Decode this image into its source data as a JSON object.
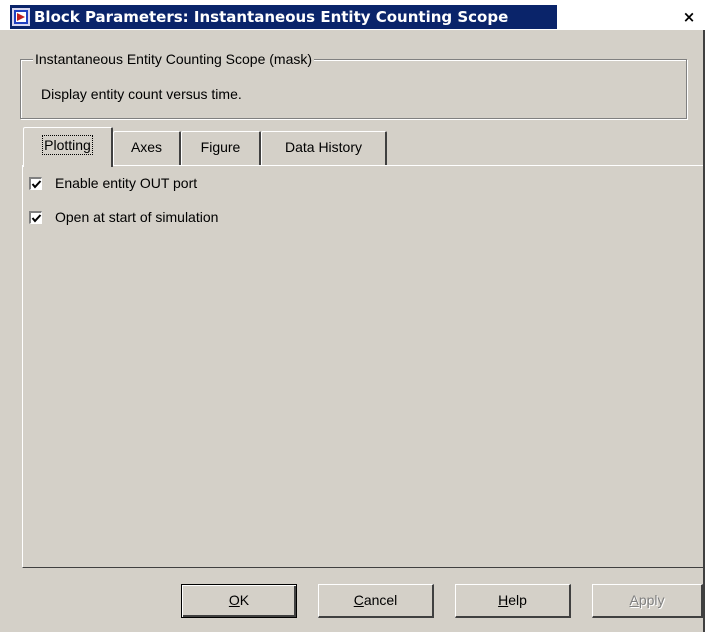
{
  "window": {
    "title": "Block Parameters: Instantaneous Entity Counting Scope",
    "close_label": "×"
  },
  "group": {
    "legend": "Instantaneous Entity Counting Scope (mask)",
    "description": "Display entity count versus time."
  },
  "tabs": [
    {
      "label": "Plotting",
      "active": true
    },
    {
      "label": "Axes",
      "active": false
    },
    {
      "label": "Figure",
      "active": false
    },
    {
      "label": "Data History",
      "active": false
    }
  ],
  "options": [
    {
      "label": "Enable entity OUT port",
      "checked": true
    },
    {
      "label": "Open at start of simulation",
      "checked": true
    }
  ],
  "buttons": {
    "ok": {
      "mnemonic": "O",
      "rest": "K"
    },
    "cancel": {
      "mnemonic": "C",
      "rest": "ancel"
    },
    "help": {
      "mnemonic": "H",
      "rest": "elp"
    },
    "apply": {
      "mnemonic": "A",
      "rest": "pply",
      "disabled": true
    }
  },
  "colors": {
    "face": "#d4d0c8",
    "title_highlight": "#0a246a"
  }
}
